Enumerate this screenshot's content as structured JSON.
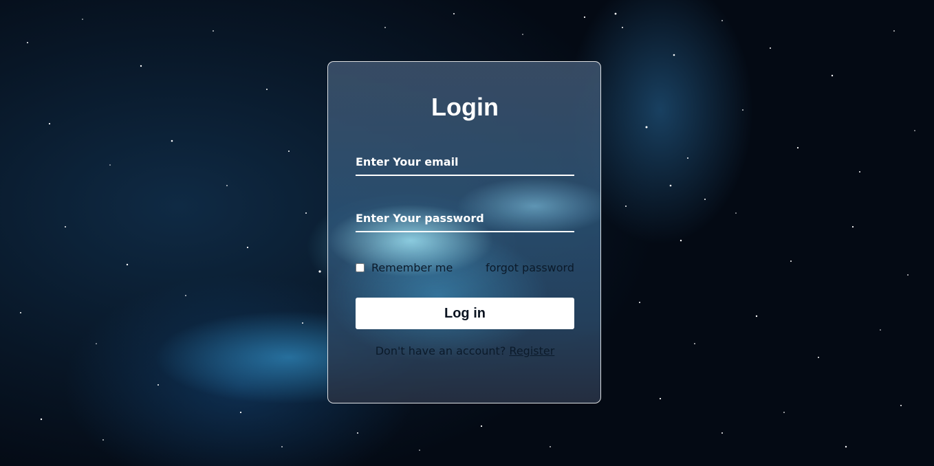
{
  "login_form": {
    "title": "Login",
    "email_placeholder": "Enter Your email",
    "password_placeholder": "Enter Your password",
    "remember_label": "Remember me",
    "forgot_label": "forgot password",
    "submit_label": "Log in",
    "register_prompt": "Don't have an account?",
    "register_link": "Register"
  }
}
